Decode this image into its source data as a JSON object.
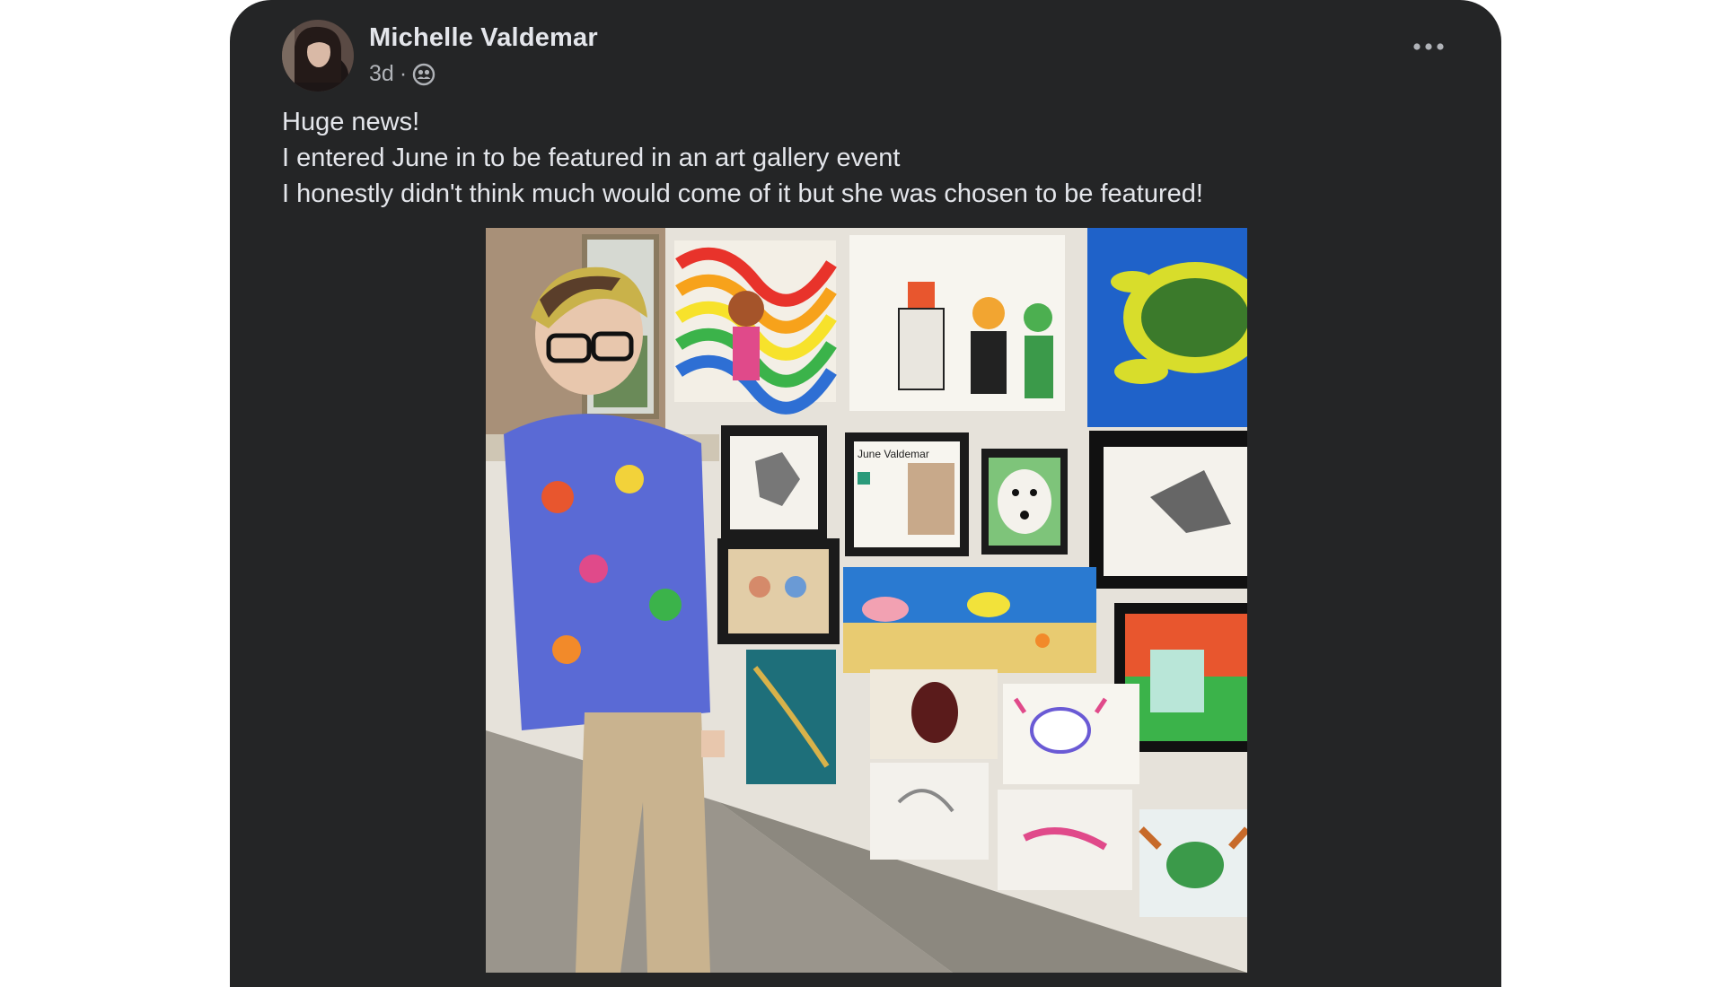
{
  "post": {
    "author": "Michelle Valdemar",
    "time": "3d",
    "separator": "·",
    "privacy_icon": "friends-icon",
    "more_icon": "more-options-icon",
    "text_lines": [
      "Huge news!",
      "I entered June in to be featured in an art gallery event",
      "I honestly didn't think much would come of it but she was chosen to be featured!"
    ]
  },
  "photo": {
    "name_card_text": "June Valdemar"
  },
  "colors": {
    "card_background": "#242526",
    "primary_text": "#e4e6eb",
    "secondary_text": "#b0b3b8"
  }
}
